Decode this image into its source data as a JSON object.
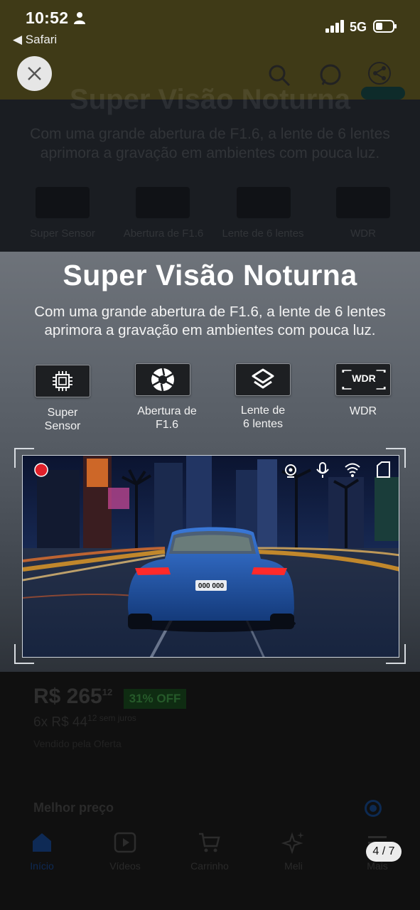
{
  "status_bar": {
    "time": "10:52",
    "back_app": "◀ Safari",
    "network": "5G"
  },
  "background": {
    "ghost_title": "Super Visão Noturna",
    "ghost_subtitle": "Com uma grande abertura de F1.6, a lente de 6 lentes aprimora a gravação em ambientes com pouca luz.",
    "ghost_features": [
      "Super Sensor",
      "Abertura de F1.6",
      "Lente de 6 lentes",
      "WDR"
    ],
    "price_main": "R$ 265",
    "price_cents": "12",
    "discount_badge": "31% OFF",
    "installments": "6x R$ 44",
    "installments_suffix": "12 sem juros",
    "seller_note": "Vendido pela Oferta",
    "best_price_label": "Melhor preço",
    "nav": [
      {
        "label": "Início",
        "icon": "home-icon"
      },
      {
        "label": "Vídeos",
        "icon": "video-icon"
      },
      {
        "label": "Carrinho",
        "icon": "cart-icon"
      },
      {
        "label": "Meli",
        "icon": "sparkle-icon"
      },
      {
        "label": "Mais",
        "icon": "menu-icon"
      }
    ]
  },
  "viewer": {
    "counter": "4 / 7",
    "title": "Super Visão Noturna",
    "subtitle_line1": "Com uma grande abertura de F1.6, a lente de 6 lentes",
    "subtitle_line2": "aprimora a gravação em ambientes com pouca luz.",
    "features": [
      {
        "line1": "Super",
        "line2": "Sensor",
        "icon": "chip-icon"
      },
      {
        "line1": "Abertura de",
        "line2": "F1.6",
        "icon": "aperture-icon"
      },
      {
        "line1": "Lente de",
        "line2": "6 lentes",
        "icon": "layers-icon"
      },
      {
        "line1": "WDR",
        "line2": "",
        "icon": "wdr-icon",
        "badge": "WDR"
      }
    ],
    "plate": "000 000",
    "colors": {
      "record": "#e0202a",
      "taillight": "#ff2a2a"
    }
  }
}
